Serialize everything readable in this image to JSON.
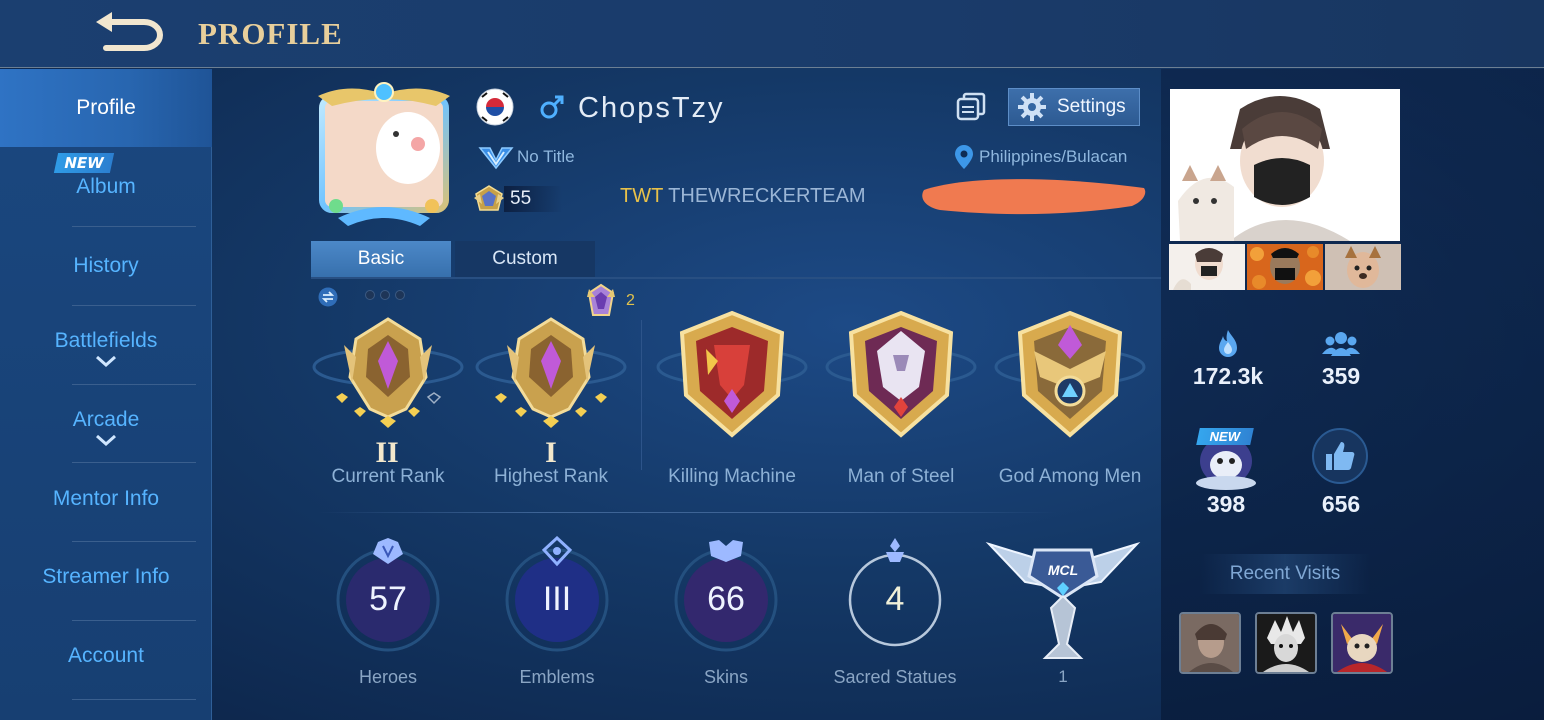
{
  "header": {
    "title": "PROFILE"
  },
  "sidebar": {
    "items": [
      {
        "label": "Profile"
      },
      {
        "label": "Album"
      },
      {
        "label": "History"
      },
      {
        "label": "Battlefields"
      },
      {
        "label": "Arcade"
      },
      {
        "label": "Mentor Info"
      },
      {
        "label": "Streamer Info"
      },
      {
        "label": "Account"
      }
    ],
    "new_badge": "NEW"
  },
  "player": {
    "name": "ChopsTzy",
    "title": "No Title",
    "level": "55",
    "squad_tag": "TWT",
    "squad_name": "THEWRECKERTEAM",
    "location": "Philippines/Bulacan"
  },
  "toolbar": {
    "settings_label": "Settings"
  },
  "tabs": [
    {
      "label": "Basic"
    },
    {
      "label": "Custom"
    }
  ],
  "mythic_count": "2",
  "medals": [
    {
      "label": "Current Rank",
      "tier": "II"
    },
    {
      "label": "Highest Rank",
      "tier": "I"
    },
    {
      "label": "Killing Machine"
    },
    {
      "label": "Man of Steel"
    },
    {
      "label": "God Among Men"
    }
  ],
  "stats": [
    {
      "label": "Heroes",
      "value": "57"
    },
    {
      "label": "Emblems",
      "value": "III"
    },
    {
      "label": "Skins",
      "value": "66"
    },
    {
      "label": "Sacred Statues",
      "value": "4"
    }
  ],
  "mcl_count": "1",
  "right": {
    "popularity": "172.3k",
    "friends": "359",
    "fans": "398",
    "likes": "656",
    "fans_new": "NEW",
    "recent_visits_label": "Recent Visits"
  },
  "colors": {
    "accent_gold": "#e8cf9b",
    "link_blue": "#56b4ff",
    "squad_gold": "#e8c14a"
  }
}
